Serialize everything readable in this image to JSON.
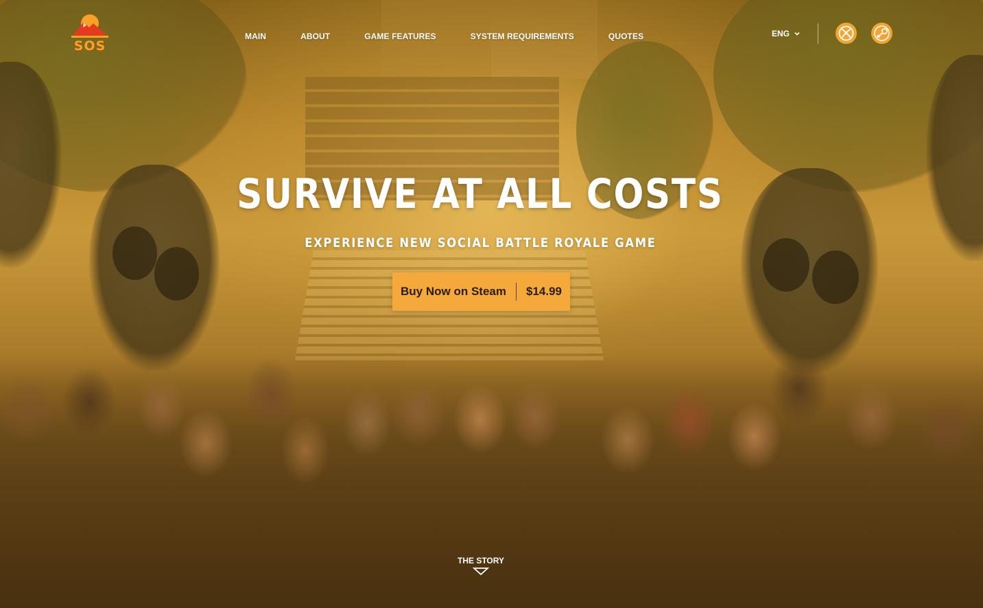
{
  "brand": {
    "logo_text": "SOS",
    "logo_colors": {
      "primary": "#f7a227",
      "accent": "#e23b1d"
    }
  },
  "nav": {
    "items": [
      {
        "label": "MAIN"
      },
      {
        "label": "ABOUT"
      },
      {
        "label": "GAME FEATURES"
      },
      {
        "label": "SYSTEM REQUIREMENTS"
      },
      {
        "label": "QUOTES"
      }
    ]
  },
  "header": {
    "language": "ENG",
    "platforms": [
      {
        "name": "xbox-icon"
      },
      {
        "name": "steam-icon"
      }
    ],
    "platform_color": "#f3a531"
  },
  "hero": {
    "title": "SURVIVE AT ALL COSTS",
    "subtitle": "EXPERIENCE NEW SOCIAL BATTLE ROYALE GAME",
    "buy_button": {
      "label": "Buy Now on Steam",
      "price": "$14.99",
      "color": "#f4a93a"
    }
  },
  "footer_link": {
    "label": "THE STORY"
  }
}
